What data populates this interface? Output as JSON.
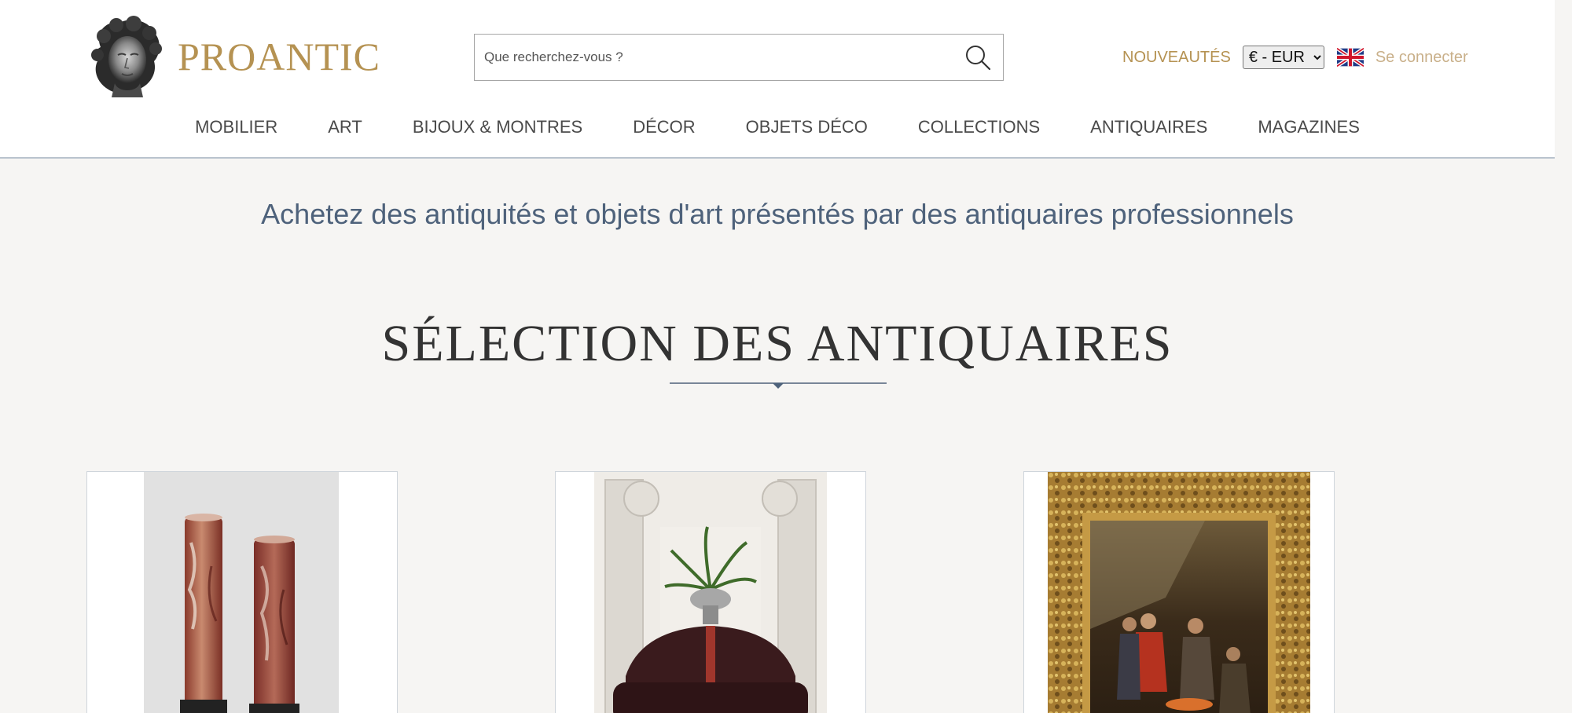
{
  "brand": {
    "name": "PROANTIC"
  },
  "search": {
    "placeholder": "Que recherchez-vous ?"
  },
  "header": {
    "new_label": "NOUVEAUTÉS",
    "currency_selected": "€ - EUR",
    "language_flag": "uk-flag-icon",
    "login_label": "Se connecter"
  },
  "nav": {
    "items": [
      {
        "label": "MOBILIER"
      },
      {
        "label": "ART"
      },
      {
        "label": "BIJOUX & MONTRES"
      },
      {
        "label": "DÉCOR"
      },
      {
        "label": "OBJETS DÉCO"
      },
      {
        "label": "COLLECTIONS"
      },
      {
        "label": "ANTIQUAIRES"
      },
      {
        "label": "MAGAZINES"
      }
    ]
  },
  "main": {
    "tagline": "Achetez des antiquités et objets d'art présentés par des antiquaires professionnels",
    "section_title": "SÉLECTION DES ANTIQUAIRES",
    "products": [
      {
        "image": "marble-columns-photo"
      },
      {
        "image": "round-sofa-photo"
      },
      {
        "image": "framed-painting-photo"
      }
    ]
  },
  "colors": {
    "brand_gold": "#b59252",
    "login_gold": "#c9b08a",
    "tagline_blue": "#4e627b",
    "divider_blue": "#4e627b",
    "page_background": "#f6f5f3",
    "header_background": "#ffffff"
  }
}
